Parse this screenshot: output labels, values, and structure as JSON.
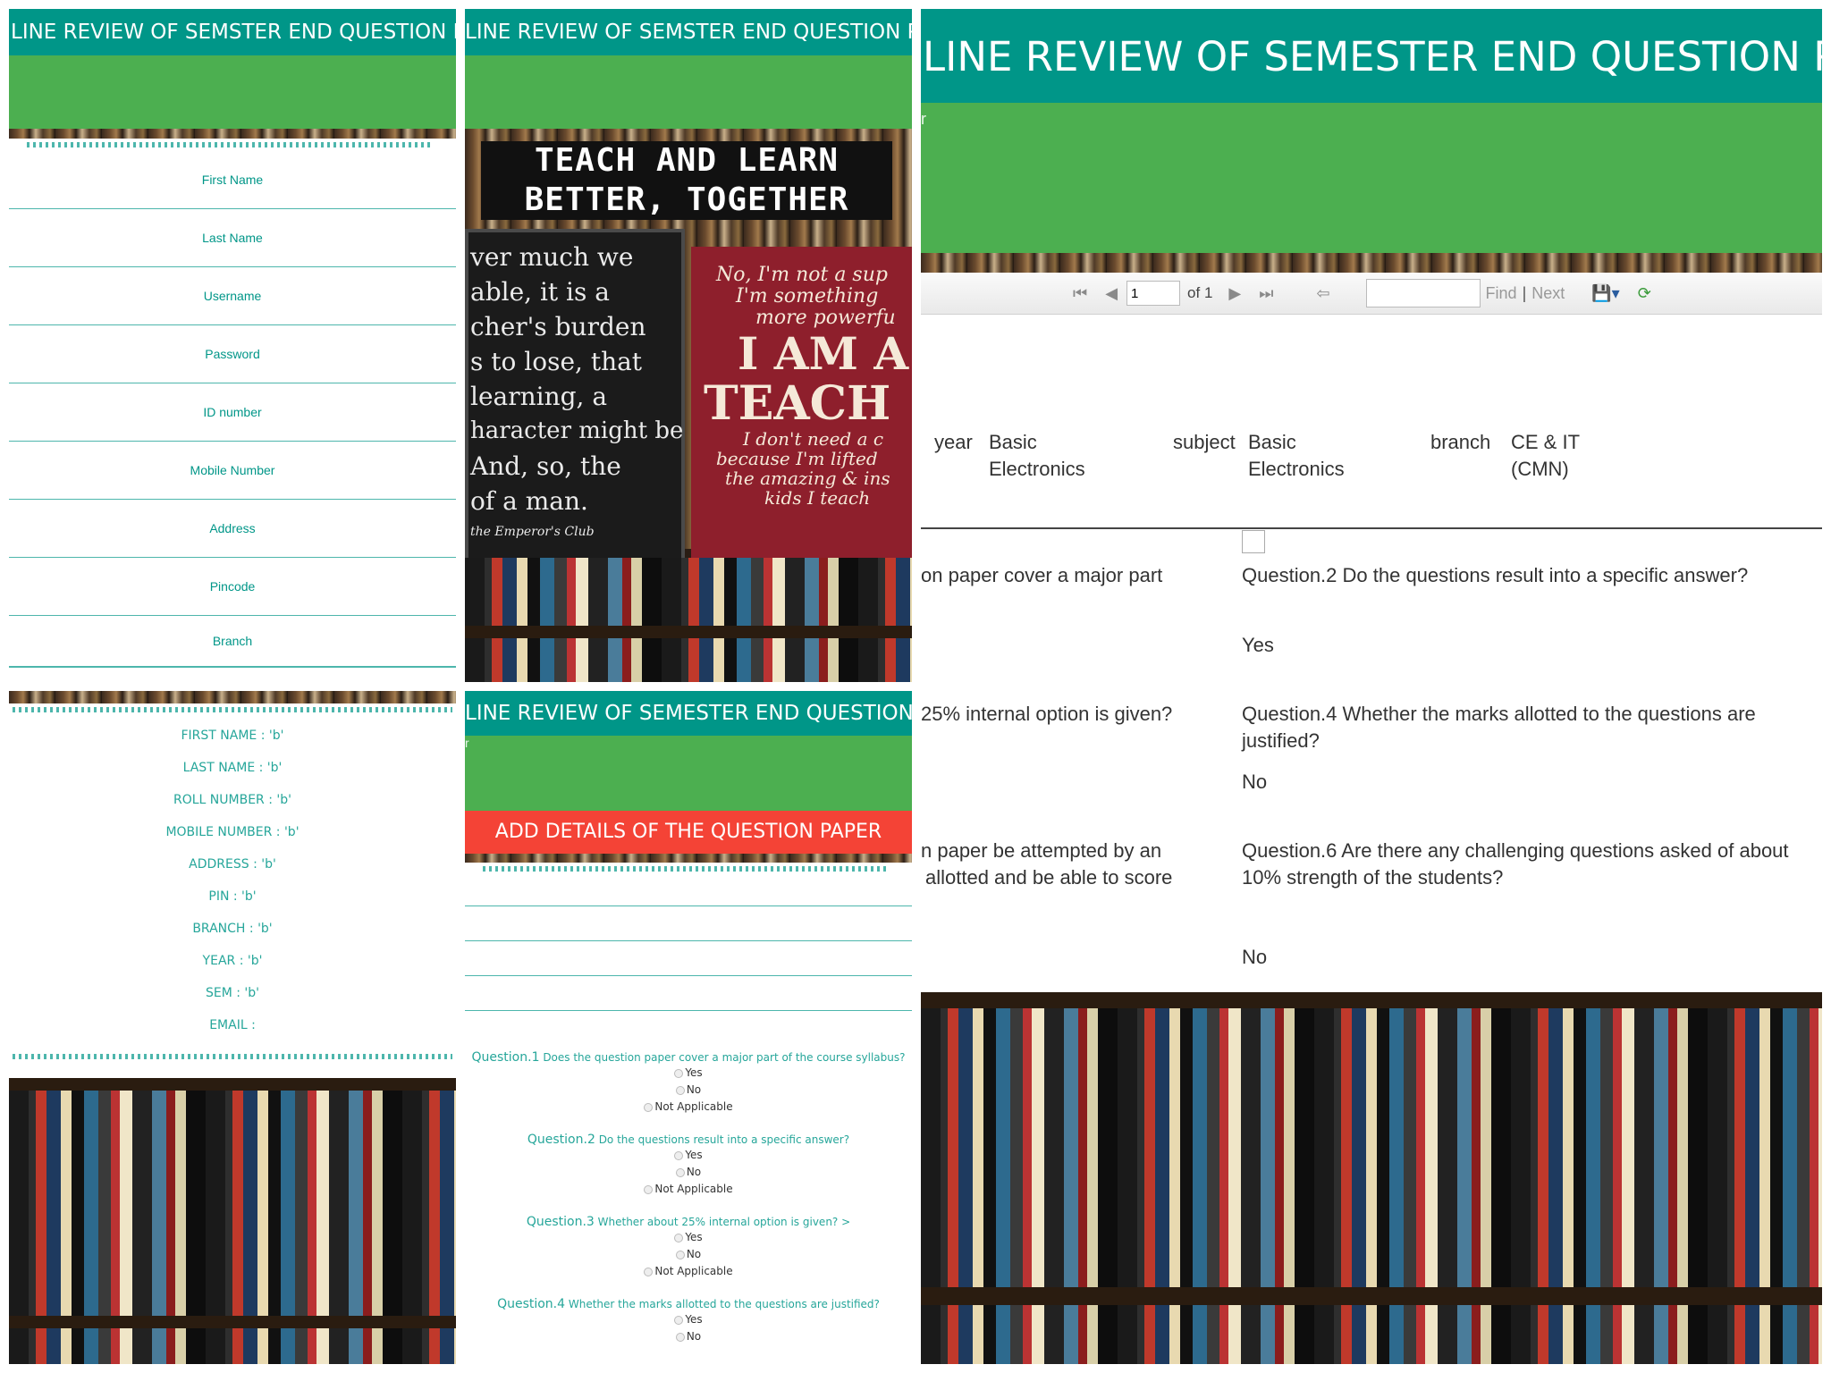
{
  "app": {
    "title": "LINE REVIEW OF SEMSTER END QUESTION PAPER"
  },
  "registration_form": {
    "fields": [
      "First Name",
      "Last Name",
      "Username",
      "Password",
      "ID number",
      "Mobile Number",
      "Address",
      "Pincode",
      "Branch"
    ]
  },
  "profile": {
    "lines": [
      "FIRST NAME : 'b'",
      "LAST NAME : 'b'",
      "ROLL NUMBER : 'b'",
      "MOBILE NUMBER : 'b'",
      "ADDRESS : 'b'",
      "PIN : 'b'",
      "BRANCH : 'b'",
      "YEAR : 'b'",
      "SEM : 'b'",
      "EMAIL :"
    ]
  },
  "posters": {
    "headline_1": "TEACH AND LEARN",
    "headline_2": "BETTER, TOGETHER",
    "chalk_lines": [
      "ver much we",
      "able, it is a",
      "cher's burden",
      "s to lose, that",
      "learning, a",
      "haracter might be",
      "And, so, the",
      "of a man.",
      "the Emperor's Club"
    ],
    "red_script_1": "No, I'm not a sup",
    "red_script_2": "I'm something",
    "red_script_3": "more powerfu",
    "red_big_1": "I AM A",
    "red_big_2": "TEACH",
    "red_script_4": "I don't need a c",
    "red_script_5": "because I'm lifted",
    "red_script_6": "the amazing & ins",
    "red_script_7": "kids I teach"
  },
  "question_form": {
    "title": "LINE REVIEW OF SEMESTER END QUESTION PAPER",
    "banner": "ADD DETAILS OF THE QUESTION PAPER",
    "edge_char": "r",
    "questions": [
      {
        "num": "Question.1",
        "text": "Does the question paper cover a major part of the course syllabus?",
        "options": [
          "Yes",
          "No",
          "Not Applicable"
        ]
      },
      {
        "num": "Question.2",
        "text": "Do the questions result into a specific answer?",
        "options": [
          "Yes",
          "No",
          "Not Applicable"
        ]
      },
      {
        "num": "Question.3",
        "text": "Whether about 25% internal option is given? >",
        "options": [
          "Yes",
          "No",
          "Not Applicable"
        ]
      },
      {
        "num": "Question.4",
        "text": "Whether the marks allotted to the questions are justified?",
        "options": [
          "Yes",
          "No"
        ]
      }
    ]
  },
  "report": {
    "title": "LINE REVIEW OF SEMESTER END QUESTION PAPER",
    "edge_char": "r",
    "toolbar": {
      "page": "1",
      "of_label": "of 1",
      "find": "Find",
      "separator": "|",
      "next": "Next"
    },
    "meta": {
      "year_label": "year",
      "year_value_1": "Basic",
      "year_value_2": "Electronics",
      "subject_label": "subject",
      "subject_value_1": "Basic",
      "subject_value_2": "Electronics",
      "branch_label": "branch",
      "branch_value_1": "CE & IT",
      "branch_value_2": "(CMN)"
    },
    "left_col": {
      "q1_fragment": "on paper cover a major part",
      "q3_fragment": "25% internal option is given?",
      "q5_fragment_1": "n paper be attempted by an",
      "q5_fragment_2": "allotted and be able to score"
    },
    "right_col": {
      "q2": "Question.2 Do the questions result into a specific answer?",
      "q2_answer": "Yes",
      "q4_line1": "Question.4 Whether the marks allotted to the questions are",
      "q4_line2": "justified?",
      "q4_answer": "No",
      "q6_line1": "Question.6 Are there any challenging questions asked of about",
      "q6_line2": "10% strength of the students?",
      "q6_answer": "No"
    }
  },
  "colors": {
    "teal": "#009688",
    "green": "#4caf50",
    "red_banner": "#f44336",
    "text_teal": "#26a69a"
  }
}
